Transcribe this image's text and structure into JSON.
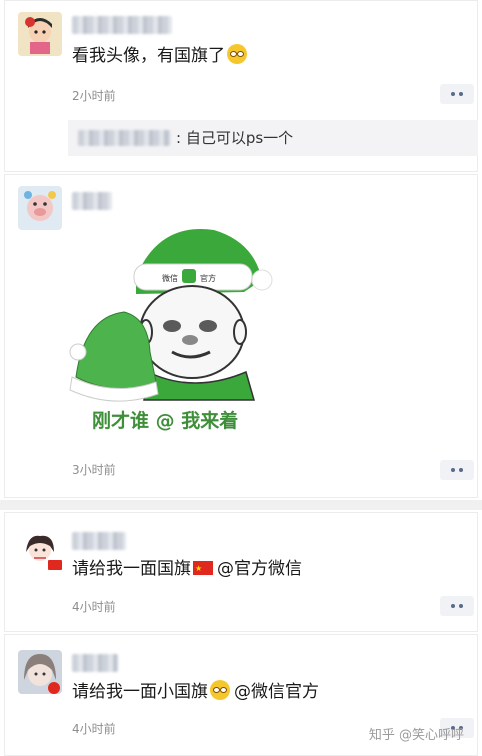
{
  "posts": [
    {
      "message": "看我头像，有国旗了",
      "time": "2小时前",
      "reply": {
        "text": ": 自己可以ps一个"
      }
    },
    {
      "sticker": {
        "hat_label": "微信官方",
        "caption": "刚才谁 @ 我来着"
      },
      "time": "3小时前"
    },
    {
      "message_before": "请给我一面国旗",
      "message_after": "@官方微信",
      "time": "4小时前"
    },
    {
      "message_before": "请给我一面小国旗",
      "message_after": "@微信官方",
      "time": "4小时前"
    }
  ],
  "watermark": "知乎 @笑心呼呼",
  "colors": {
    "flag_red": "#e0281f",
    "sticker_green": "#3f8f3a",
    "more_dots": "#5a6a8a"
  },
  "icons": [
    "grimace-emoji-icon",
    "china-flag-icon",
    "grin-emoji-icon",
    "more-dots-icon"
  ]
}
